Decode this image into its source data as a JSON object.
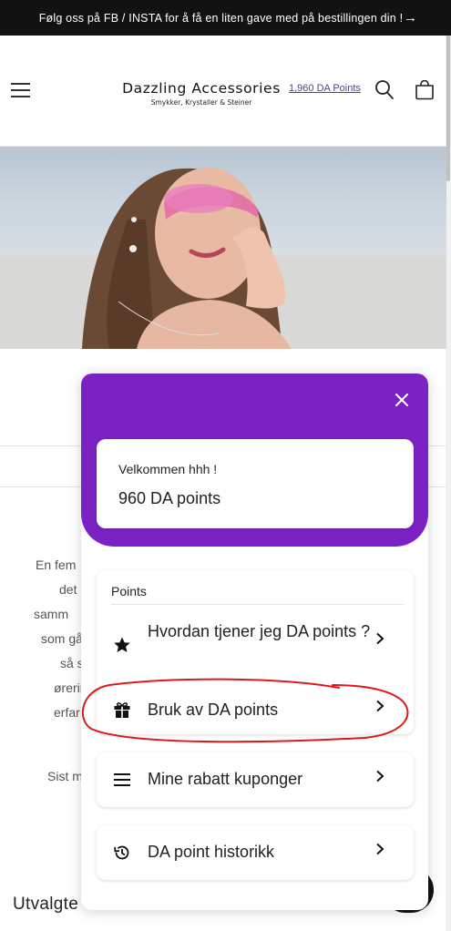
{
  "announcement": {
    "text": "Følg oss på FB / INSTA for å få en liten gave med på bestillingen din !",
    "arrow_icon": "arrow-right-icon"
  },
  "header": {
    "brand_name": "Dazzling Accessories",
    "brand_tagline": "Smykker, Krystaller & Steiner",
    "points_link": "1,960 DA Points",
    "icons": [
      "menu-icon",
      "search-icon",
      "cart-icon"
    ]
  },
  "background_text": {
    "lines": [
      "En fem",
      "det",
      "samm",
      "som gå",
      "så st",
      "ørerin",
      "erfar"
    ],
    "last_line": "Sist m",
    "bottom_heading": "Utvalgte"
  },
  "rewards_panel": {
    "colors": {
      "header_bg": "#7b22c4",
      "annotation": "#e0171b"
    },
    "welcome": "Velkommen hhh !",
    "balance": "960 DA points",
    "section_title": "Points",
    "items": [
      {
        "label": "Hvordan tjener jeg DA points ?",
        "icon": "star-icon"
      },
      {
        "label": "Bruk av DA points",
        "icon": "gift-icon"
      }
    ],
    "coupons": {
      "label": "Mine rabatt kuponger",
      "icon": "list-icon"
    },
    "history": {
      "label": "DA point historikk",
      "icon": "history-icon"
    }
  }
}
